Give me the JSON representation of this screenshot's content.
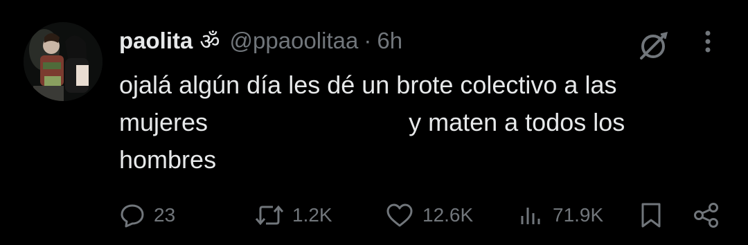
{
  "tweet": {
    "display_name": "paolita",
    "name_emoji": "ॐ",
    "handle": "@ppaoolitaa",
    "separator": "·",
    "time": "6h",
    "text_lines": [
      "ojalá algún día les dé un brote colectivo a las",
      "mujeres                             y maten a todos los",
      "hombres"
    ]
  },
  "actions": {
    "replies": "23",
    "reposts": "1.2K",
    "likes": "12.6K",
    "views": "71.9K"
  },
  "icons": {
    "grok": "grok-icon",
    "more": "more-vertical-icon",
    "reply": "reply-icon",
    "repost": "repost-icon",
    "like": "heart-icon",
    "views": "views-chart-icon",
    "bookmark": "bookmark-icon",
    "share": "share-icon"
  },
  "colors": {
    "background": "#000000",
    "text": "#e7e9ea",
    "muted": "#71767b"
  }
}
